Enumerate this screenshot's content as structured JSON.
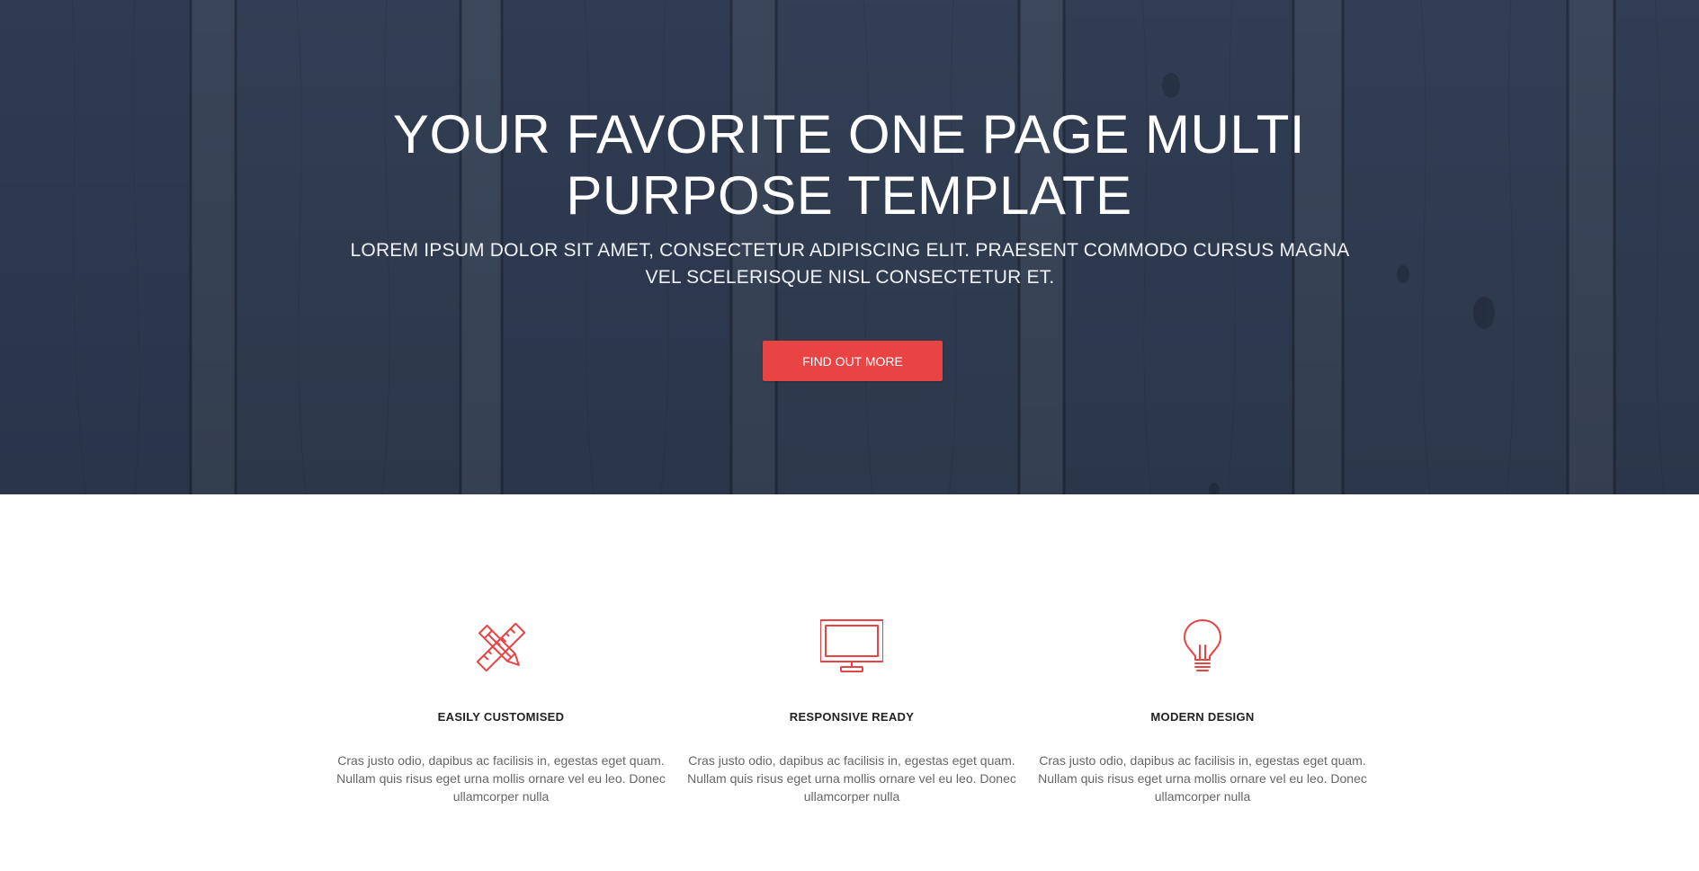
{
  "hero": {
    "title": "YOUR FAVORITE ONE PAGE MULTI PURPOSE TEMPLATE",
    "subtitle": "LOREM IPSUM DOLOR SIT AMET, CONSECTETUR ADIPISCING ELIT. PRAESENT COMMODO CURSUS MAGNA VEL SCELERISQUE NISL CONSECTETUR ET.",
    "button_label": "FIND OUT MORE"
  },
  "features": [
    {
      "icon": "pencil-ruler-icon",
      "title": "EASILY CUSTOMISED",
      "text": "Cras justo odio, dapibus ac facilisis in, egestas eget quam. Nullam quis risus eget urna mollis ornare vel eu leo. Donec ullamcorper nulla"
    },
    {
      "icon": "monitor-icon",
      "title": "RESPONSIVE READY",
      "text": "Cras justo odio, dapibus ac facilisis in, egestas eget quam. Nullam quis risus eget urna mollis ornare vel eu leo. Donec ullamcorper nulla"
    },
    {
      "icon": "lightbulb-icon",
      "title": "MODERN DESIGN",
      "text": "Cras justo odio, dapibus ac facilisis in, egestas eget quam. Nullam quis risus eget urna mollis ornare vel eu leo. Donec ullamcorper nulla"
    }
  ],
  "colors": {
    "accent": "#e84444",
    "hero_wood": "#384459",
    "heading": "#222222",
    "body_text": "#666666"
  }
}
